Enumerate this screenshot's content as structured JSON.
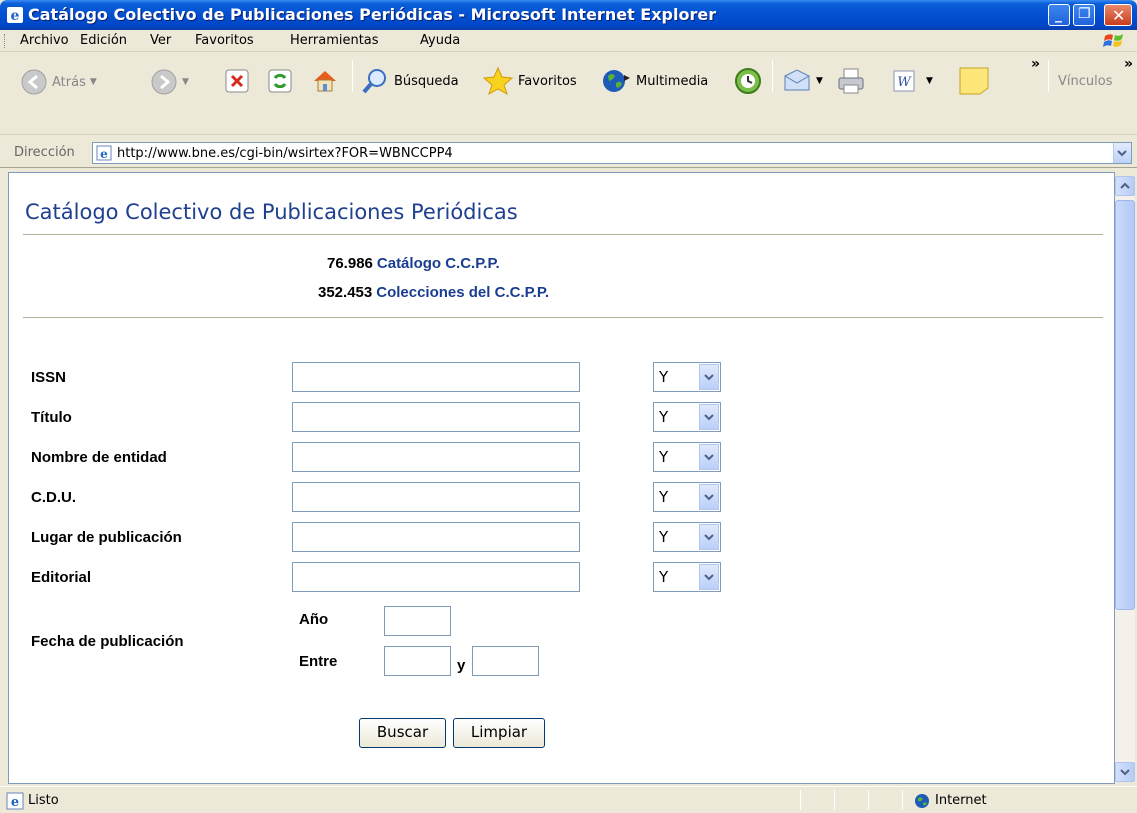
{
  "window": {
    "title": "Catálogo Colectivo de Publicaciones Periódicas - Microsoft Internet Explorer",
    "minimize": "_",
    "restore": "❐",
    "close": "✕"
  },
  "menubar": {
    "items": [
      "Archivo",
      "Edición",
      "Ver",
      "Favoritos",
      "Herramientas",
      "Ayuda"
    ]
  },
  "toolbar": {
    "back": "Atrás",
    "search": "Búsqueda",
    "favorites": "Favoritos",
    "media": "Multimedia",
    "links": "Vínculos",
    "chevron": "»"
  },
  "address": {
    "label": "Dirección",
    "url": "http://www.bne.es/cgi-bin/wsirtex?FOR=WBNCCPP4"
  },
  "page": {
    "heading": "Catálogo Colectivo de Publicaciones Periódicas",
    "stats": [
      {
        "count": "76.986",
        "link": "Catálogo C.C.P.P."
      },
      {
        "count": "352.453",
        "link": "Colecciones del C.C.P.P."
      }
    ],
    "fields": [
      {
        "label": "ISSN",
        "operator": "Y"
      },
      {
        "label": "Título",
        "operator": "Y"
      },
      {
        "label": "Nombre de entidad",
        "operator": "Y"
      },
      {
        "label": "C.D.U.",
        "operator": "Y"
      },
      {
        "label": "Lugar de publicación",
        "operator": "Y"
      },
      {
        "label": "Editorial",
        "operator": "Y"
      }
    ],
    "date": {
      "label": "Fecha de publicación",
      "year_label": "Año",
      "between_label": "Entre",
      "and_label": "y"
    },
    "buttons": {
      "search": "Buscar",
      "clear": "Limpiar"
    }
  },
  "status": {
    "text": "Listo",
    "zone": "Internet"
  }
}
